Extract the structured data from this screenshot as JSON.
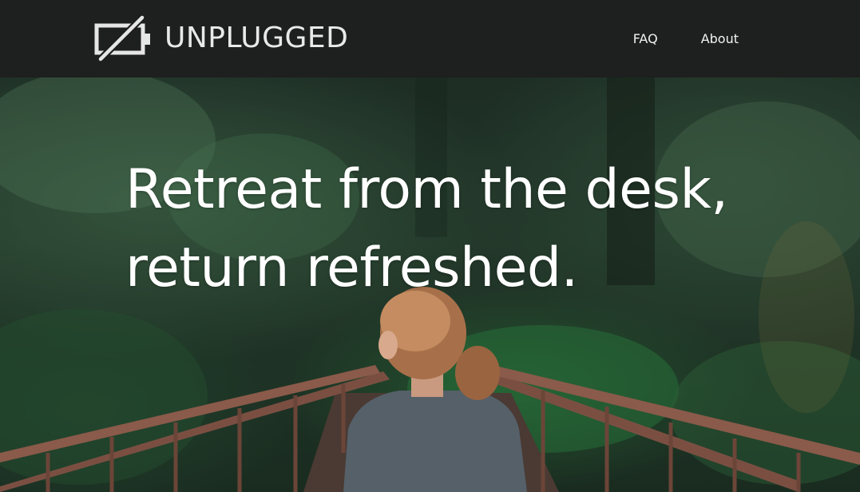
{
  "header": {
    "brand": "UNPLUGGED",
    "logo_icon": "battery-slash-icon",
    "nav": [
      {
        "label": "FAQ"
      },
      {
        "label": "About"
      }
    ]
  },
  "hero": {
    "headline_line1": "Retreat from the desk,",
    "headline_line2": "return refreshed.",
    "image_description_icon": "forest-bridge-photo"
  },
  "colors": {
    "header_bg": "#1e1f1f",
    "nav_text": "#f2f2f2",
    "headline_text": "#ffffff"
  }
}
